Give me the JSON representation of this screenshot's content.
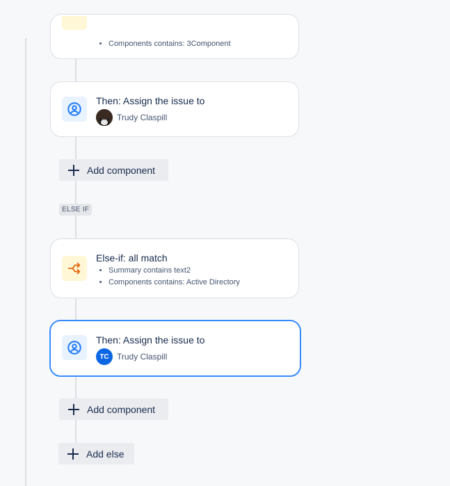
{
  "top_card": {
    "conditions": [
      "Components contains: 3Component"
    ]
  },
  "action_card_1": {
    "title": "Then: Assign the issue to",
    "assignee": "Trudy Claspill"
  },
  "add_component_1": {
    "label": "Add component"
  },
  "else_if_lozenge": "ELSE IF",
  "else_if_card": {
    "title": "Else-if: all match",
    "conditions": [
      "Summary contains text2",
      "Components contains: Active Directory"
    ]
  },
  "action_card_2": {
    "title": "Then: Assign the issue to",
    "assignee": "Trudy Claspill",
    "avatar_initials": "TC"
  },
  "add_component_2": {
    "label": "Add component"
  },
  "add_else": {
    "label": "Add else"
  },
  "colors": {
    "background": "#f7f8f9",
    "accent_blue": "#0c66e4",
    "selected_border": "#388bff",
    "condition_icon": "#e56910"
  },
  "icons": {
    "action": "person-circle-icon",
    "condition": "branch-icon",
    "add": "plus-icon"
  }
}
